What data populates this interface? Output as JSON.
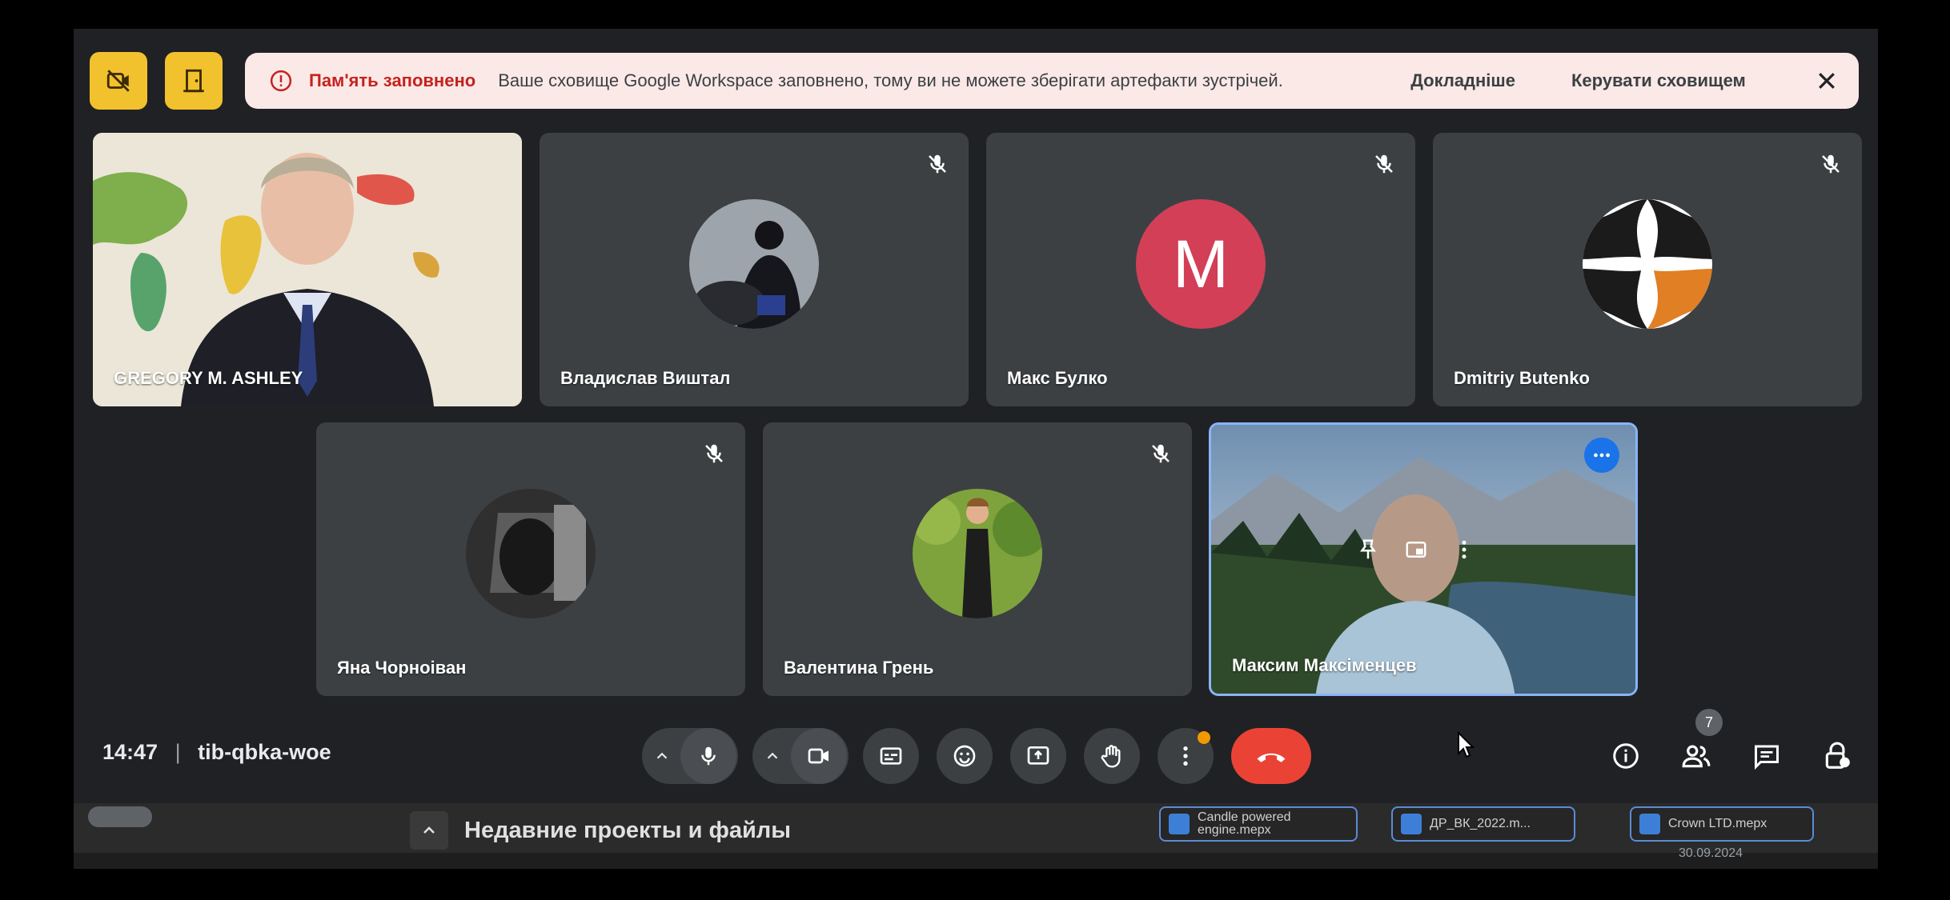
{
  "banner": {
    "title": "Пам'ять заповнено",
    "message": "Ваше сховище Google Workspace заповнено, тому ви не можете зберігати артефакти зустрічей.",
    "details_link": "Докладніше",
    "manage_link": "Керувати сховищем"
  },
  "participants": [
    {
      "name": "GREGORY M. ASHLEY",
      "mic_muted": false,
      "video": true
    },
    {
      "name": "Владислав Виштал",
      "mic_muted": true,
      "video": false
    },
    {
      "name": "Макс Булко",
      "mic_muted": true,
      "video": false,
      "avatar_letter": "M",
      "avatar_color": "#d23f57"
    },
    {
      "name": "Dmitriy Butenko",
      "mic_muted": true,
      "video": false
    },
    {
      "name": "Яна Чорноіван",
      "mic_muted": true,
      "video": false
    },
    {
      "name": "Валентина Грень",
      "mic_muted": true,
      "video": false
    },
    {
      "name": "Максим Максіменцев",
      "mic_muted": false,
      "video": true,
      "is_self": true
    }
  ],
  "meeting": {
    "time": "14:47",
    "code": "tib-qbka-woe",
    "people_count": "7"
  },
  "controls": {
    "mic": "on",
    "camera": "on",
    "more_notification": true
  },
  "taskbar": {
    "recent_label": "Недавние проекты и файлы",
    "files": [
      "Candle powered engine.mepx",
      "ДР_ВК_2022.m...",
      "Crown LTD.mepx"
    ],
    "date": "30.09.2024"
  },
  "colors": {
    "accent": "#8ab4f8",
    "warning_bg": "#fbe9e7",
    "warning_text": "#c5221f",
    "end_call": "#ea4335",
    "top_buttons": "#f2c12e"
  }
}
